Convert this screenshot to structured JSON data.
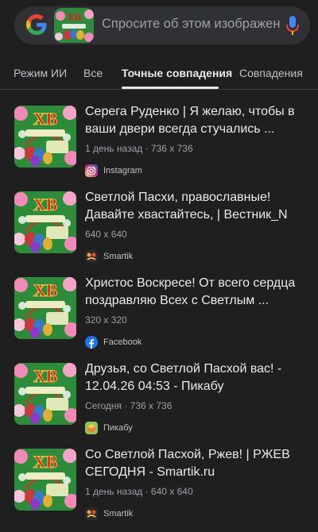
{
  "search": {
    "placeholder": "Спросите об этом изображени"
  },
  "tabs": [
    {
      "label": "Режим ИИ",
      "active": false
    },
    {
      "label": "Все",
      "active": false
    },
    {
      "label": "Точные совпадения",
      "active": true
    },
    {
      "label": "Совпадения",
      "active": false
    }
  ],
  "results": [
    {
      "title": "Серега Руденко | Я желаю, чтобы в ваши двери всегда стучались ...",
      "meta": "1 день назад · 736 x 736",
      "source": "Instagram",
      "source_icon": "instagram-icon",
      "thumb_text": "ХВ"
    },
    {
      "title": "Светлой Пасхи, православные! Давайте хвастайтесь, | Вестник_N",
      "meta": "640 x 640",
      "source": "Smartik",
      "source_icon": "smartik-icon",
      "thumb_text": "ХВ"
    },
    {
      "title": "Христос Воскресе! От всего сердца поздравляю Всех с Светлым ...",
      "meta": "320 x 320",
      "source": "Facebook",
      "source_icon": "facebook-icon",
      "thumb_text": "ХВ"
    },
    {
      "title": "Друзья, со Светлой Пасхой вас! - 12.04.26 04:53 - Пикабу",
      "meta": "Сегодня · 736 x 736",
      "source": "Пикабу",
      "source_icon": "pikabu-icon",
      "thumb_text": "ХВ"
    },
    {
      "title": "Со Светлой Пасхой, Ржев! | РЖЕВ СЕГОДНЯ - Smartik.ru",
      "meta": "1 день назад · 640 x 640",
      "source": "Smartik",
      "source_icon": "smartik-icon",
      "thumb_text": "ХВ"
    }
  ],
  "colors": {
    "background": "#1f1f1f",
    "search_bg": "#303134",
    "text": "#e8eaed",
    "muted": "#9aa0a6"
  }
}
